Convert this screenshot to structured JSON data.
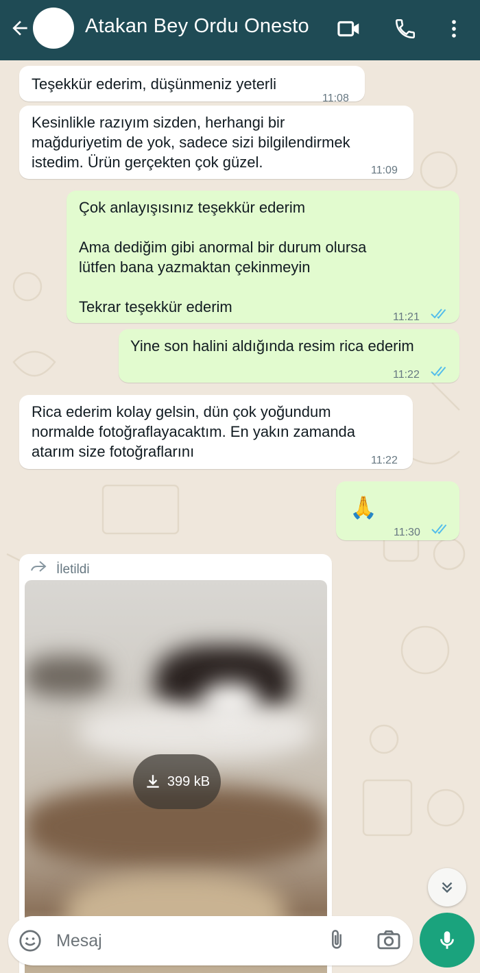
{
  "header": {
    "contact_name": "Atakan Bey Ordu Onesto",
    "back_icon": "arrow-left-icon",
    "video_icon": "video-call-icon",
    "call_icon": "phone-icon",
    "menu_icon": "more-vertical-icon",
    "background": "#1f4b55"
  },
  "messages": [
    {
      "direction": "incoming",
      "text": "Teşekkür ederim, düşünmeniz yeterli",
      "time": "11:08"
    },
    {
      "direction": "incoming",
      "text": "Kesinlikle razıyım sizden, herhangi bir\nmağduriyetim de yok, sadece sizi bilgilendirmek\nistedim. Ürün gerçekten çok güzel.",
      "time": "11:09"
    },
    {
      "direction": "outgoing",
      "text": "Çok anlayışısınız teşekkür ederim\n\nAma dediğim gibi anormal bir durum olursa\nlütfen bana yazmaktan çekinmeyin\n\nTekrar teşekkür ederim",
      "time": "11:21",
      "status": "read"
    },
    {
      "direction": "outgoing",
      "text": "Yine son halini aldığında resim rica ederim",
      "time": "11:22",
      "status": "read"
    },
    {
      "direction": "incoming",
      "text": "Rica ederim kolay gelsin, dün çok yoğundum\nnormalde fotoğraflayacaktım. En yakın zamanda\natarım size fotoğraflarını",
      "time": "11:22"
    },
    {
      "direction": "outgoing",
      "text": "🙏",
      "time": "11:30",
      "status": "read"
    }
  ],
  "media_message": {
    "direction": "incoming",
    "forwarded_label": "İletildi",
    "download_size": "399 kB"
  },
  "input": {
    "placeholder": "Mesaj",
    "emoji_icon": "emoji-icon",
    "attach_icon": "paperclip-icon",
    "camera_icon": "camera-icon",
    "mic_icon": "microphone-icon"
  },
  "colors": {
    "incoming_bubble": "#ffffff",
    "outgoing_bubble": "#e2fbcf",
    "read_ticks": "#53bdeb",
    "accent": "#1aa37d",
    "wallpaper": "#efe7dc"
  }
}
